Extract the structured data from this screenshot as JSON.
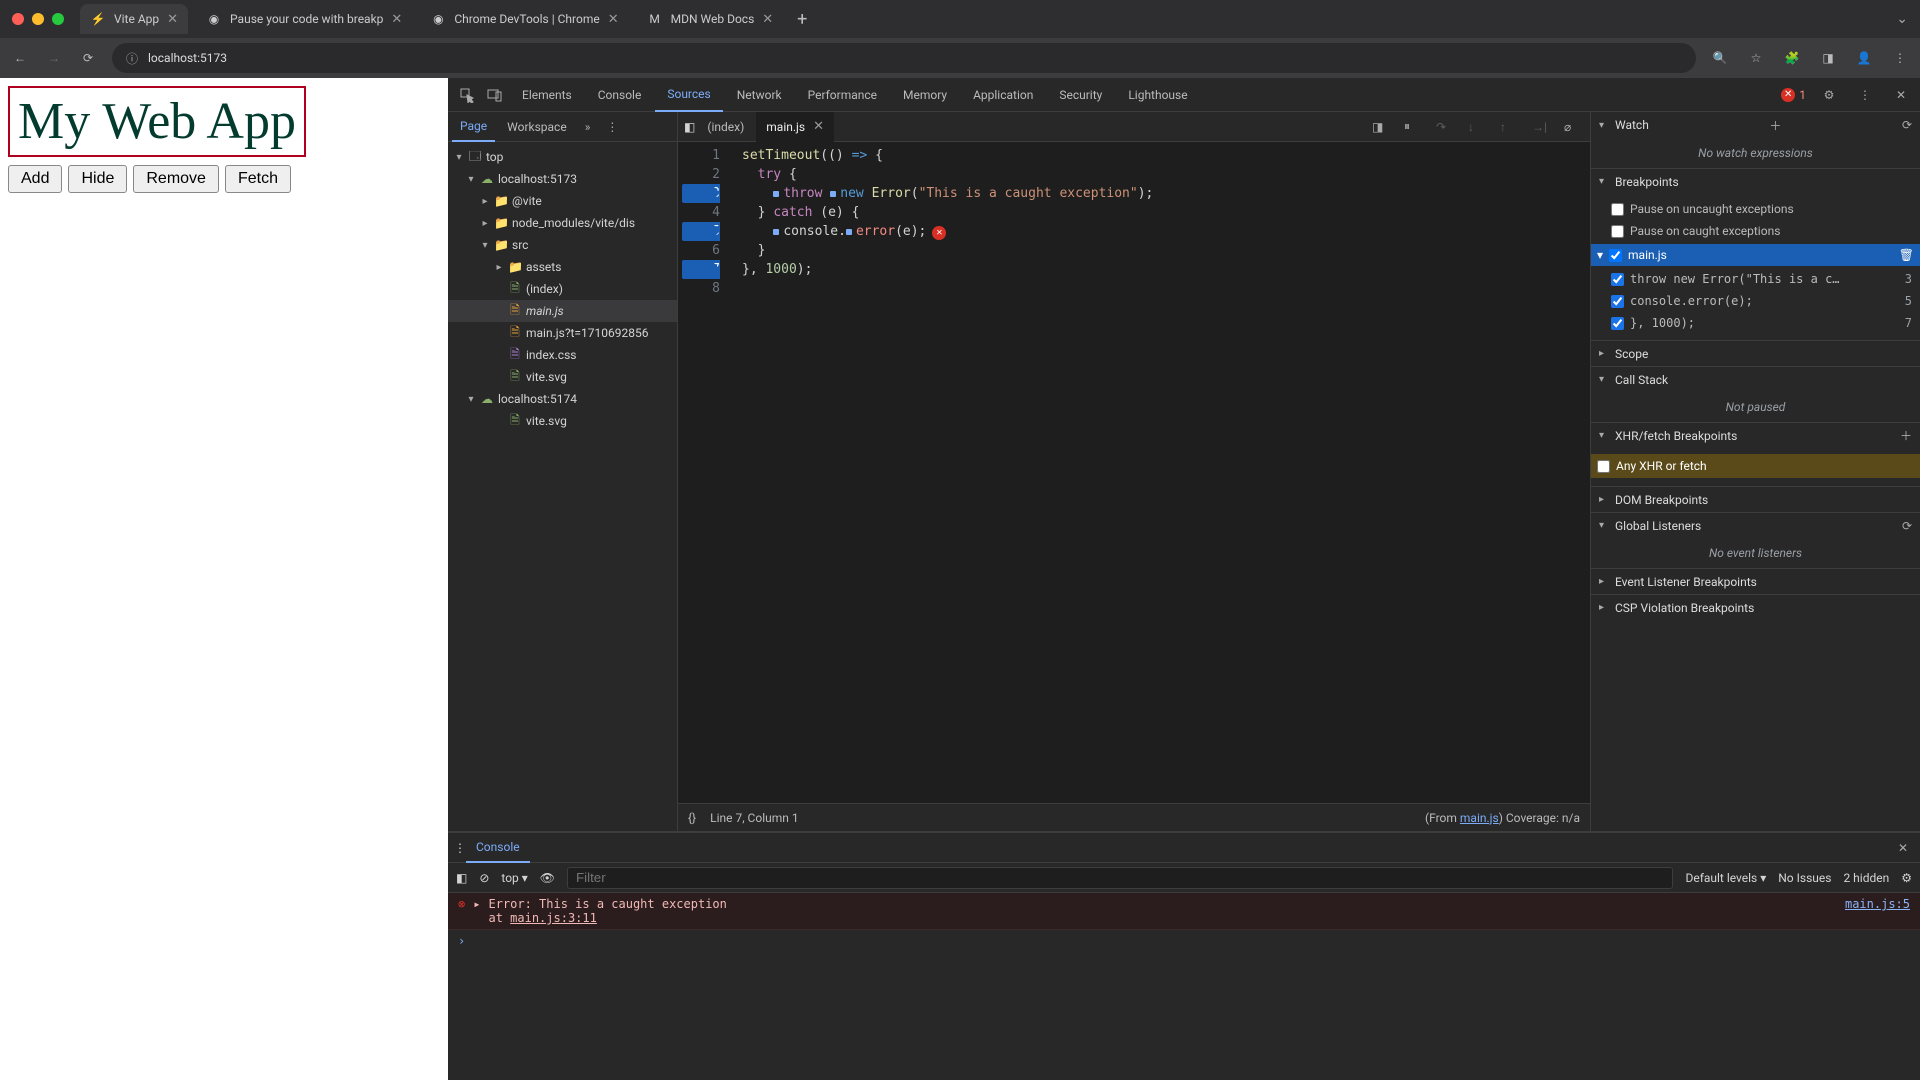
{
  "chrome": {
    "tabs": [
      {
        "title": "Vite App",
        "favicon": "V"
      },
      {
        "title": "Pause your code with breakp",
        "favicon": "●"
      },
      {
        "title": "Chrome DevTools | Chrome",
        "favicon": "●"
      },
      {
        "title": "MDN Web Docs",
        "favicon": "M"
      }
    ],
    "url": "localhost:5173"
  },
  "page": {
    "heading": "My Web App",
    "buttons": [
      "Add",
      "Hide",
      "Remove",
      "Fetch"
    ]
  },
  "devtools": {
    "panels": [
      "Elements",
      "Console",
      "Sources",
      "Network",
      "Performance",
      "Memory",
      "Application",
      "Security",
      "Lighthouse"
    ],
    "active_panel": "Sources",
    "error_count": 1
  },
  "navigator": {
    "tabs": [
      "Page",
      "Workspace"
    ],
    "tree": {
      "root": "top",
      "origin1": "localhost:5173",
      "dirs": [
        "@vite",
        "node_modules/vite/dis",
        "src",
        "assets"
      ],
      "files": [
        "(index)",
        "main.js",
        "main.js?t=1710692856",
        "index.css",
        "vite.svg"
      ],
      "origin2": "localhost:5174",
      "origin2_files": [
        "vite.svg"
      ]
    },
    "selected": "main.js"
  },
  "editor": {
    "tabs": [
      "(index)",
      "main.js"
    ],
    "active_tab": "main.js",
    "code": {
      "l1": "setTimeout(() => {",
      "l2": "  try {",
      "l3_pre": "    ",
      "l3_kw1": "throw ",
      "l3_kw2": "new ",
      "l3_rest": "Error(",
      "l3_str": "\"This is a caught exception\"",
      "l3_end": ");",
      "l4": "  } catch (e) {",
      "l5_pre": "    ",
      "l5_c": "console.",
      "l5_err": "error",
      "l5_end": "(e);",
      "l6": "  }",
      "l7": "}, 1000);",
      "l8": ""
    },
    "breakpoint_lines": [
      3,
      5,
      7
    ],
    "status": {
      "prefix": "Line 7, Column 1",
      "from_label": "(From ",
      "from_file": "main.js",
      "coverage_label": ") Coverage: n/a"
    }
  },
  "debugger": {
    "watch": {
      "title": "Watch",
      "empty": "No watch expressions"
    },
    "breakpoints": {
      "title": "Breakpoints",
      "pause_uncaught": "Pause on uncaught exceptions",
      "pause_caught": "Pause on caught exceptions",
      "file": "main.js",
      "items": [
        {
          "checked": true,
          "code": "throw new Error(\"This is a c…",
          "line": 3
        },
        {
          "checked": true,
          "code": "console.error(e);",
          "line": 5
        },
        {
          "checked": true,
          "code": "}, 1000);",
          "line": 7
        }
      ]
    },
    "scope": {
      "title": "Scope"
    },
    "callstack": {
      "title": "Call Stack",
      "empty": "Not paused"
    },
    "xhr": {
      "title": "XHR/fetch Breakpoints",
      "any": "Any XHR or fetch"
    },
    "dom": {
      "title": "DOM Breakpoints"
    },
    "global": {
      "title": "Global Listeners",
      "empty": "No event listeners"
    },
    "evlistener": {
      "title": "Event Listener Breakpoints"
    },
    "csp": {
      "title": "CSP Violation Breakpoints"
    }
  },
  "drawer": {
    "tab": "Console",
    "context": "top",
    "filter_placeholder": "Filter",
    "levels": "Default levels",
    "no_issues": "No Issues",
    "hidden": "2 hidden",
    "log": {
      "msg_l1": "Error: This is a caught exception",
      "msg_l2": "    at ",
      "msg_l2_link": "main.js:3:11",
      "src": "main.js:5"
    }
  }
}
